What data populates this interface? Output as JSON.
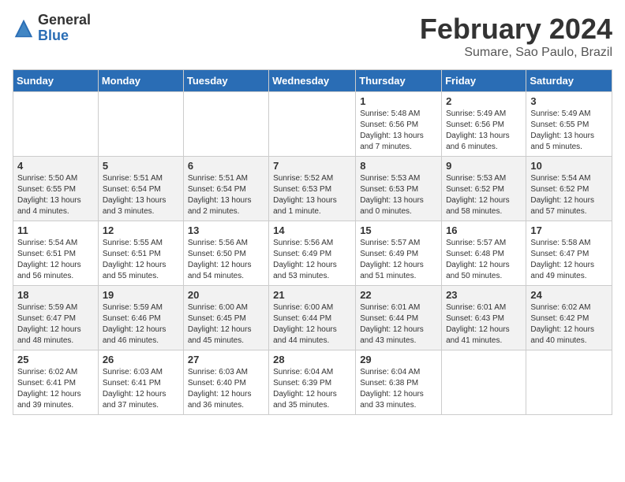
{
  "logo": {
    "general": "General",
    "blue": "Blue"
  },
  "title": "February 2024",
  "subtitle": "Sumare, Sao Paulo, Brazil",
  "headers": [
    "Sunday",
    "Monday",
    "Tuesday",
    "Wednesday",
    "Thursday",
    "Friday",
    "Saturday"
  ],
  "weeks": [
    [
      {
        "day": "",
        "info": ""
      },
      {
        "day": "",
        "info": ""
      },
      {
        "day": "",
        "info": ""
      },
      {
        "day": "",
        "info": ""
      },
      {
        "day": "1",
        "info": "Sunrise: 5:48 AM\nSunset: 6:56 PM\nDaylight: 13 hours and 7 minutes."
      },
      {
        "day": "2",
        "info": "Sunrise: 5:49 AM\nSunset: 6:56 PM\nDaylight: 13 hours and 6 minutes."
      },
      {
        "day": "3",
        "info": "Sunrise: 5:49 AM\nSunset: 6:55 PM\nDaylight: 13 hours and 5 minutes."
      }
    ],
    [
      {
        "day": "4",
        "info": "Sunrise: 5:50 AM\nSunset: 6:55 PM\nDaylight: 13 hours and 4 minutes."
      },
      {
        "day": "5",
        "info": "Sunrise: 5:51 AM\nSunset: 6:54 PM\nDaylight: 13 hours and 3 minutes."
      },
      {
        "day": "6",
        "info": "Sunrise: 5:51 AM\nSunset: 6:54 PM\nDaylight: 13 hours and 2 minutes."
      },
      {
        "day": "7",
        "info": "Sunrise: 5:52 AM\nSunset: 6:53 PM\nDaylight: 13 hours and 1 minute."
      },
      {
        "day": "8",
        "info": "Sunrise: 5:53 AM\nSunset: 6:53 PM\nDaylight: 13 hours and 0 minutes."
      },
      {
        "day": "9",
        "info": "Sunrise: 5:53 AM\nSunset: 6:52 PM\nDaylight: 12 hours and 58 minutes."
      },
      {
        "day": "10",
        "info": "Sunrise: 5:54 AM\nSunset: 6:52 PM\nDaylight: 12 hours and 57 minutes."
      }
    ],
    [
      {
        "day": "11",
        "info": "Sunrise: 5:54 AM\nSunset: 6:51 PM\nDaylight: 12 hours and 56 minutes."
      },
      {
        "day": "12",
        "info": "Sunrise: 5:55 AM\nSunset: 6:51 PM\nDaylight: 12 hours and 55 minutes."
      },
      {
        "day": "13",
        "info": "Sunrise: 5:56 AM\nSunset: 6:50 PM\nDaylight: 12 hours and 54 minutes."
      },
      {
        "day": "14",
        "info": "Sunrise: 5:56 AM\nSunset: 6:49 PM\nDaylight: 12 hours and 53 minutes."
      },
      {
        "day": "15",
        "info": "Sunrise: 5:57 AM\nSunset: 6:49 PM\nDaylight: 12 hours and 51 minutes."
      },
      {
        "day": "16",
        "info": "Sunrise: 5:57 AM\nSunset: 6:48 PM\nDaylight: 12 hours and 50 minutes."
      },
      {
        "day": "17",
        "info": "Sunrise: 5:58 AM\nSunset: 6:47 PM\nDaylight: 12 hours and 49 minutes."
      }
    ],
    [
      {
        "day": "18",
        "info": "Sunrise: 5:59 AM\nSunset: 6:47 PM\nDaylight: 12 hours and 48 minutes."
      },
      {
        "day": "19",
        "info": "Sunrise: 5:59 AM\nSunset: 6:46 PM\nDaylight: 12 hours and 46 minutes."
      },
      {
        "day": "20",
        "info": "Sunrise: 6:00 AM\nSunset: 6:45 PM\nDaylight: 12 hours and 45 minutes."
      },
      {
        "day": "21",
        "info": "Sunrise: 6:00 AM\nSunset: 6:44 PM\nDaylight: 12 hours and 44 minutes."
      },
      {
        "day": "22",
        "info": "Sunrise: 6:01 AM\nSunset: 6:44 PM\nDaylight: 12 hours and 43 minutes."
      },
      {
        "day": "23",
        "info": "Sunrise: 6:01 AM\nSunset: 6:43 PM\nDaylight: 12 hours and 41 minutes."
      },
      {
        "day": "24",
        "info": "Sunrise: 6:02 AM\nSunset: 6:42 PM\nDaylight: 12 hours and 40 minutes."
      }
    ],
    [
      {
        "day": "25",
        "info": "Sunrise: 6:02 AM\nSunset: 6:41 PM\nDaylight: 12 hours and 39 minutes."
      },
      {
        "day": "26",
        "info": "Sunrise: 6:03 AM\nSunset: 6:41 PM\nDaylight: 12 hours and 37 minutes."
      },
      {
        "day": "27",
        "info": "Sunrise: 6:03 AM\nSunset: 6:40 PM\nDaylight: 12 hours and 36 minutes."
      },
      {
        "day": "28",
        "info": "Sunrise: 6:04 AM\nSunset: 6:39 PM\nDaylight: 12 hours and 35 minutes."
      },
      {
        "day": "29",
        "info": "Sunrise: 6:04 AM\nSunset: 6:38 PM\nDaylight: 12 hours and 33 minutes."
      },
      {
        "day": "",
        "info": ""
      },
      {
        "day": "",
        "info": ""
      }
    ]
  ]
}
